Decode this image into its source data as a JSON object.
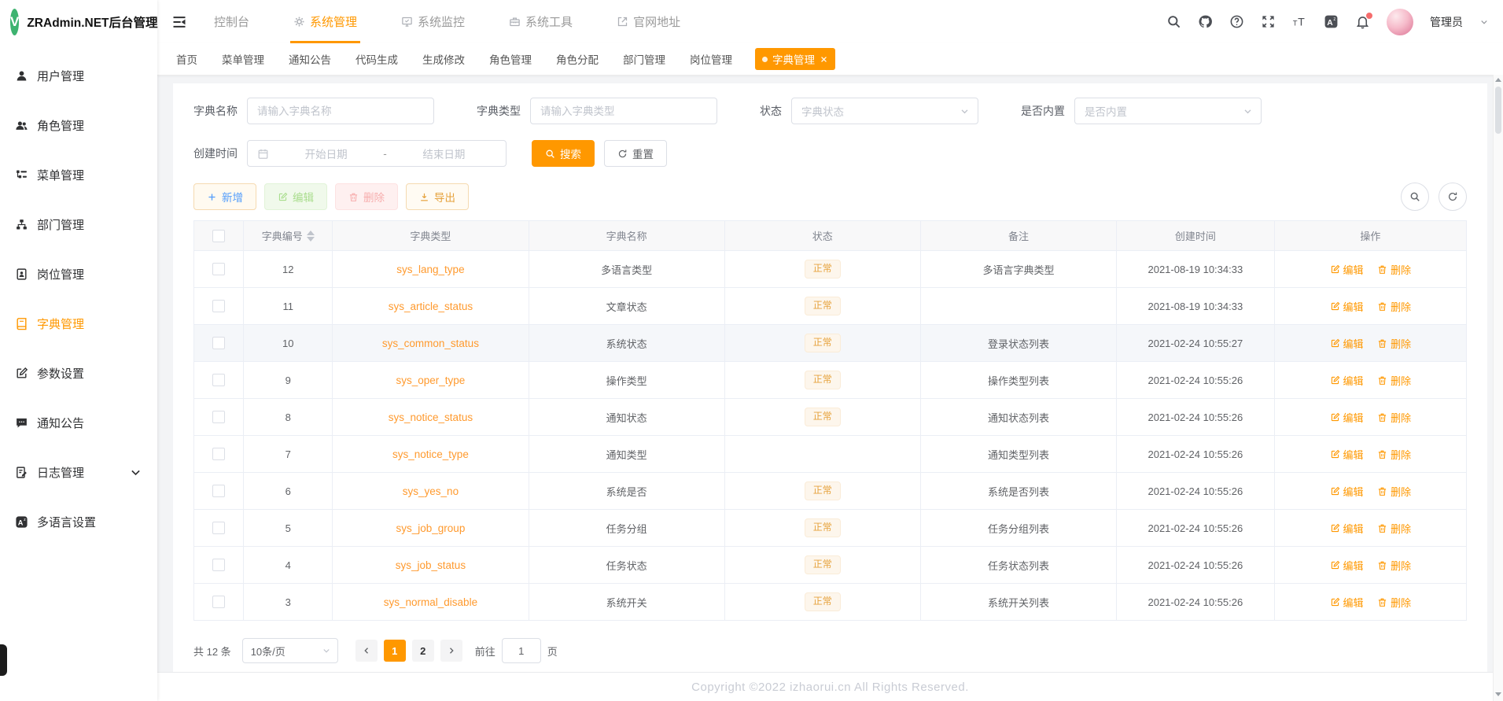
{
  "colors": {
    "theme_orange": "#ff9800",
    "link_orange": "#ff9a2e",
    "badge_text": "#e6a23c",
    "badge_bg": "#fdf6ec",
    "logo_green": "#3eb370",
    "notify_red": "#f56c6c",
    "disabled_green": "#a9dd8d",
    "disabled_red": "#f7aeae"
  },
  "brand": {
    "logo_letter": "V",
    "title": "ZRAdmin.NET后台管理"
  },
  "topnav": {
    "items": [
      {
        "label": "控制台",
        "icon": "",
        "state_class": ""
      },
      {
        "label": "系统管理",
        "icon": "gear",
        "state_class": "active"
      },
      {
        "label": "系统监控",
        "icon": "monitor",
        "state_class": ""
      },
      {
        "label": "系统工具",
        "icon": "toolbox",
        "state_class": ""
      },
      {
        "label": "官网地址",
        "icon": "external-link",
        "state_class": ""
      }
    ],
    "action_icons": [
      {
        "icon": "search",
        "has_dot": false
      },
      {
        "icon": "github",
        "has_dot": false
      },
      {
        "icon": "question",
        "has_dot": false
      },
      {
        "icon": "fullscreen",
        "has_dot": false
      },
      {
        "icon": "font-size",
        "has_dot": false
      },
      {
        "icon": "language",
        "has_dot": false
      },
      {
        "icon": "bell",
        "has_dot": true
      }
    ],
    "user": {
      "name": "管理员"
    }
  },
  "sidebar": {
    "items": [
      {
        "label": "用户管理",
        "icon": "user",
        "state_class": "",
        "has_arrow": false
      },
      {
        "label": "角色管理",
        "icon": "users",
        "state_class": "",
        "has_arrow": false
      },
      {
        "label": "菜单管理",
        "icon": "menu-tree",
        "state_class": "",
        "has_arrow": false
      },
      {
        "label": "部门管理",
        "icon": "org",
        "state_class": "",
        "has_arrow": false
      },
      {
        "label": "岗位管理",
        "icon": "badge",
        "state_class": "",
        "has_arrow": false
      },
      {
        "label": "字典管理",
        "icon": "book",
        "state_class": "active",
        "has_arrow": false
      },
      {
        "label": "参数设置",
        "icon": "edit-square",
        "state_class": "",
        "has_arrow": false
      },
      {
        "label": "通知公告",
        "icon": "comment",
        "state_class": "",
        "has_arrow": false
      },
      {
        "label": "日志管理",
        "icon": "log",
        "state_class": "",
        "has_arrow": true
      },
      {
        "label": "多语言设置",
        "icon": "language",
        "state_class": "",
        "has_arrow": false
      }
    ]
  },
  "tabs": {
    "items": [
      {
        "label": "首页",
        "state_class": "",
        "active": false,
        "closable": false
      },
      {
        "label": "菜单管理",
        "state_class": "",
        "active": false,
        "closable": false
      },
      {
        "label": "通知公告",
        "state_class": "",
        "active": false,
        "closable": false
      },
      {
        "label": "代码生成",
        "state_class": "",
        "active": false,
        "closable": false
      },
      {
        "label": "生成修改",
        "state_class": "",
        "active": false,
        "closable": false
      },
      {
        "label": "角色管理",
        "state_class": "",
        "active": false,
        "closable": false
      },
      {
        "label": "角色分配",
        "state_class": "",
        "active": false,
        "closable": false
      },
      {
        "label": "部门管理",
        "state_class": "",
        "active": false,
        "closable": false
      },
      {
        "label": "岗位管理",
        "state_class": "",
        "active": false,
        "closable": false
      },
      {
        "label": "字典管理",
        "state_class": "active",
        "active": true,
        "closable": true
      }
    ]
  },
  "search_form": {
    "dict_name": {
      "label": "字典名称",
      "placeholder": "请输入字典名称",
      "value": ""
    },
    "dict_type": {
      "label": "字典类型",
      "placeholder": "请输入字典类型",
      "value": ""
    },
    "status": {
      "label": "状态",
      "placeholder": "字典状态"
    },
    "builtin": {
      "label": "是否内置",
      "placeholder": "是否内置"
    },
    "create_time": {
      "label": "创建时间",
      "start_placeholder": "开始日期",
      "separator": "-",
      "end_placeholder": "结束日期"
    },
    "search_label": "搜索",
    "reset_label": "重置"
  },
  "toolbar": {
    "add_label": "新增",
    "edit_label": "编辑",
    "delete_label": "删除",
    "export_label": "导出"
  },
  "table": {
    "columns": [
      "字典编号",
      "字典类型",
      "字典名称",
      "状态",
      "备注",
      "创建时间",
      "操作"
    ],
    "edit_label": "编辑",
    "delete_label": "删除",
    "rows": [
      {
        "id": "12",
        "type": "sys_lang_type",
        "name": "多语言类型",
        "status": "正常",
        "remark": "多语言字典类型",
        "created": "2021-08-19 10:34:33",
        "row_class": ""
      },
      {
        "id": "11",
        "type": "sys_article_status",
        "name": "文章状态",
        "status": "正常",
        "remark": "",
        "created": "2021-08-19 10:34:33",
        "row_class": ""
      },
      {
        "id": "10",
        "type": "sys_common_status",
        "name": "系统状态",
        "status": "正常",
        "remark": "登录状态列表",
        "created": "2021-02-24 10:55:27",
        "row_class": "highlighted"
      },
      {
        "id": "9",
        "type": "sys_oper_type",
        "name": "操作类型",
        "status": "正常",
        "remark": "操作类型列表",
        "created": "2021-02-24 10:55:26",
        "row_class": ""
      },
      {
        "id": "8",
        "type": "sys_notice_status",
        "name": "通知状态",
        "status": "正常",
        "remark": "通知状态列表",
        "created": "2021-02-24 10:55:26",
        "row_class": ""
      },
      {
        "id": "7",
        "type": "sys_notice_type",
        "name": "通知类型",
        "status": "",
        "remark": "通知类型列表",
        "created": "2021-02-24 10:55:26",
        "row_class": ""
      },
      {
        "id": "6",
        "type": "sys_yes_no",
        "name": "系统是否",
        "status": "正常",
        "remark": "系统是否列表",
        "created": "2021-02-24 10:55:26",
        "row_class": ""
      },
      {
        "id": "5",
        "type": "sys_job_group",
        "name": "任务分组",
        "status": "正常",
        "remark": "任务分组列表",
        "created": "2021-02-24 10:55:26",
        "row_class": ""
      },
      {
        "id": "4",
        "type": "sys_job_status",
        "name": "任务状态",
        "status": "正常",
        "remark": "任务状态列表",
        "created": "2021-02-24 10:55:26",
        "row_class": ""
      },
      {
        "id": "3",
        "type": "sys_normal_disable",
        "name": "系统开关",
        "status": "正常",
        "remark": "系统开关列表",
        "created": "2021-02-24 10:55:26",
        "row_class": ""
      }
    ]
  },
  "pagination": {
    "total_label": "共 12 条",
    "page_size_label": "10条/页",
    "pages": [
      {
        "label": "1",
        "state_class": "active"
      },
      {
        "label": "2",
        "state_class": ""
      }
    ],
    "goto_label": "前往",
    "goto_value": "1",
    "page_suffix": "页"
  },
  "footer": {
    "copyright": "Copyright ©2022 izhaorui.cn All Rights Reserved."
  }
}
